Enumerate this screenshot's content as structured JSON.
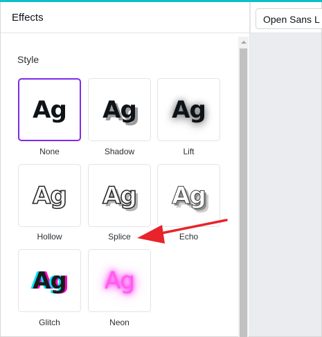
{
  "panel": {
    "title": "Effects",
    "section_title": "Style"
  },
  "toolbar": {
    "font_dropdown_value": "Open Sans L"
  },
  "effects": [
    {
      "label": "None",
      "sample": "Ag",
      "selected": true
    },
    {
      "label": "Shadow",
      "sample": "Ag",
      "selected": false
    },
    {
      "label": "Lift",
      "sample": "Ag",
      "selected": false
    },
    {
      "label": "Hollow",
      "sample": "Ag",
      "selected": false
    },
    {
      "label": "Splice",
      "sample": "Ag",
      "selected": false
    },
    {
      "label": "Echo",
      "sample": "Ag",
      "selected": false
    },
    {
      "label": "Glitch",
      "sample": "Ag",
      "selected": false
    },
    {
      "label": "Neon",
      "sample": "Ag",
      "selected": false
    }
  ],
  "colors": {
    "selected_border": "#7d2ae8",
    "accent_strip": "#0dbfcc",
    "annotation_arrow": "#e8232a",
    "neon": "#ff5cf0",
    "glitch_cyan": "#00e5ff",
    "glitch_magenta": "#ff00c8"
  },
  "annotation": {
    "icon": "red-arrow-icon",
    "points_to": "Splice"
  }
}
